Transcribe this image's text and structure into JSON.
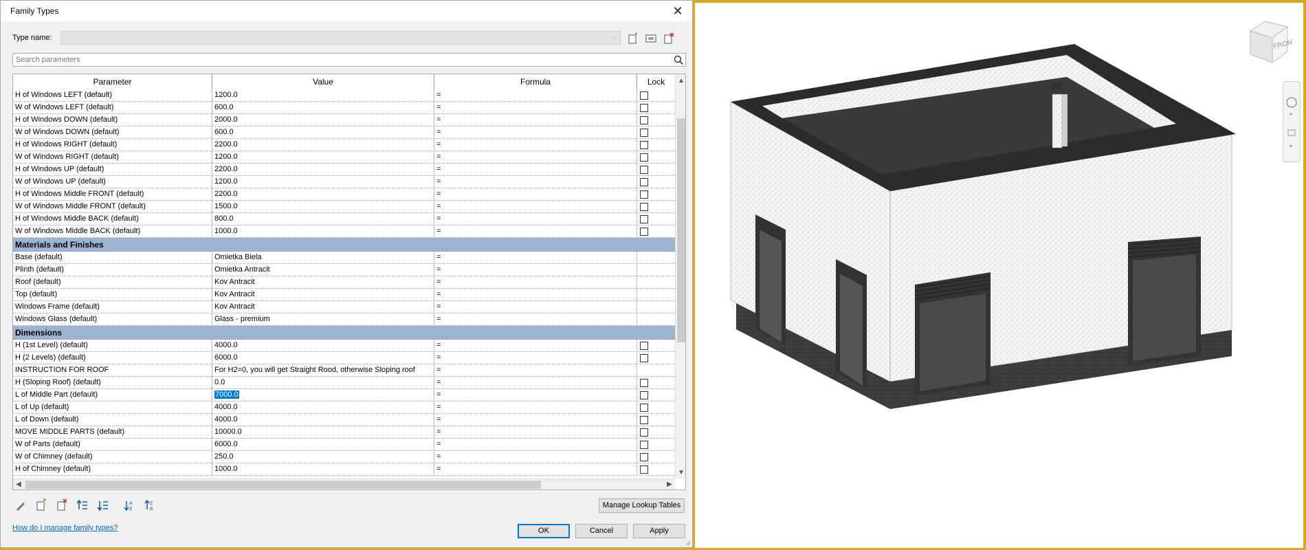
{
  "dialog": {
    "title": "Family Types",
    "type_name_label": "Type name:",
    "type_name_value": "",
    "search_placeholder": "Search parameters",
    "columns": [
      "Parameter",
      "Value",
      "Formula",
      "Lock"
    ],
    "sections": [
      {
        "rows": [
          {
            "param": "H of Windows LEFT (default)",
            "value": "1200.0",
            "formula": "=",
            "lock": true
          },
          {
            "param": "W of Windows LEFT (default)",
            "value": "600.0",
            "formula": "=",
            "lock": true
          },
          {
            "param": "H of Windows DOWN (default)",
            "value": "2000.0",
            "formula": "=",
            "lock": true
          },
          {
            "param": "W of Windows DOWN (default)",
            "value": "600.0",
            "formula": "=",
            "lock": true
          },
          {
            "param": "H of Windows RIGHT (default)",
            "value": "2200.0",
            "formula": "=",
            "lock": true
          },
          {
            "param": "W of Windows RIGHT (default)",
            "value": "1200.0",
            "formula": "=",
            "lock": true
          },
          {
            "param": "H of Windows  UP (default)",
            "value": "2200.0",
            "formula": "=",
            "lock": true
          },
          {
            "param": "W of Windows UP (default)",
            "value": "1200.0",
            "formula": "=",
            "lock": true
          },
          {
            "param": "H of Windows Middle FRONT (default)",
            "value": "2200.0",
            "formula": "=",
            "lock": true
          },
          {
            "param": "W of Windows Middle FRONT (default)",
            "value": "1500.0",
            "formula": "=",
            "lock": true
          },
          {
            "param": "H of Windows Middle BACK (default)",
            "value": "800.0",
            "formula": "=",
            "lock": true
          },
          {
            "param": "W of Windows Middle BACK (default)",
            "value": "1000.0",
            "formula": "=",
            "lock": true
          }
        ]
      },
      {
        "group": "Materials and Finishes",
        "rows": [
          {
            "param": "Base (default)",
            "value": "Omietka Biela",
            "formula": "=",
            "lock": false
          },
          {
            "param": "Plinth (default)",
            "value": "Omietka Antracit",
            "formula": "=",
            "lock": false
          },
          {
            "param": "Roof (default)",
            "value": "Kov Antracit",
            "formula": "=",
            "lock": false
          },
          {
            "param": "Top (default)",
            "value": "Kov Antracit",
            "formula": "=",
            "lock": false
          },
          {
            "param": "Windows Frame (default)",
            "value": "Kov Antracit",
            "formula": "=",
            "lock": false
          },
          {
            "param": "Windows Glass (default)",
            "value": "Glass - premium",
            "formula": "=",
            "lock": false
          }
        ]
      },
      {
        "group": "Dimensions",
        "rows": [
          {
            "param": "H (1st Level) (default)",
            "value": "4000.0",
            "formula": "=",
            "lock": true
          },
          {
            "param": "H (2 Levels) (default)",
            "value": "6000.0",
            "formula": "=",
            "lock": true
          },
          {
            "param": "INSTRUCTION FOR ROOF",
            "value": "For H2=0, you will get Straight Rood, otherwise Sloping roof",
            "formula": "=",
            "lock": false
          },
          {
            "param": "H (Sloping Roof) (default)",
            "value": "0.0",
            "formula": "=",
            "lock": true
          },
          {
            "param": "L of Middle Part (default)",
            "value": "7000.0",
            "formula": "=",
            "lock": true,
            "selected": true
          },
          {
            "param": "L of Up (default)",
            "value": "4000.0",
            "formula": "=",
            "lock": true
          },
          {
            "param": "L of Down (default)",
            "value": "4000.0",
            "formula": "=",
            "lock": true
          },
          {
            "param": "MOVE MIDDLE PARTS (default)",
            "value": "10000.0",
            "formula": "=",
            "lock": true
          },
          {
            "param": "W of Parts (default)",
            "value": "6000.0",
            "formula": "=",
            "lock": true
          },
          {
            "param": "W of Chimney (default)",
            "value": "250.0",
            "formula": "=",
            "lock": true
          },
          {
            "param": "H of Chimney (default)",
            "value": "1000.0",
            "formula": "=",
            "lock": true
          }
        ]
      }
    ],
    "buttons": {
      "manage_lookup": "Manage Lookup Tables",
      "ok": "OK",
      "cancel": "Cancel",
      "apply": "Apply"
    },
    "help_link": "How do I manage family types?"
  },
  "viewport": {
    "viewcube_label": "FRONT",
    "accent": "#0078d7",
    "group_header_color": "#9db3cf"
  }
}
